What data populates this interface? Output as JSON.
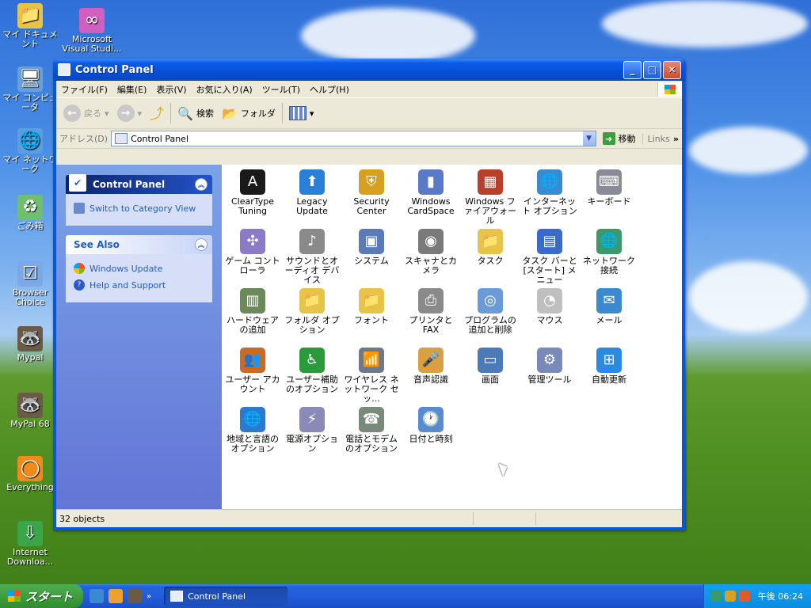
{
  "desktop": {
    "icons": [
      {
        "label": "マイ ドキュメント",
        "glyph": "📁",
        "color": "#e8c34a"
      },
      {
        "label": "Microsoft Visual Studi...",
        "glyph": "∞",
        "color": "#d060c0"
      },
      {
        "label": "マイ コンピュータ",
        "glyph": "🖥",
        "color": "#6a9fd8"
      },
      {
        "label": "マイ ネットワーク",
        "glyph": "🌐",
        "color": "#5a9fe0"
      },
      {
        "label": "ごみ箱",
        "glyph": "♻",
        "color": "#6fbf6f"
      },
      {
        "label": "Browser Choice",
        "glyph": "☑",
        "color": "#7aa8e8"
      },
      {
        "label": "Mypal",
        "glyph": "🦝",
        "color": "#6b5a45"
      },
      {
        "label": "MyPal 68",
        "glyph": "🦝",
        "color": "#6b5a45"
      },
      {
        "label": "Everything",
        "glyph": "◯",
        "color": "#f08a1a"
      },
      {
        "label": "Internet Downloa...",
        "glyph": "⇩",
        "color": "#3aa64a"
      }
    ]
  },
  "window": {
    "title": "Control Panel",
    "buttons": {
      "minimize": "_",
      "maximize": "□",
      "close": "✕"
    },
    "menu": [
      "ファイル(F)",
      "編集(E)",
      "表示(V)",
      "お気に入り(A)",
      "ツール(T)",
      "ヘルプ(H)"
    ],
    "toolbar": {
      "back": "戻る",
      "search": "検索",
      "folders": "フォルダ"
    },
    "address": {
      "label": "アドレス(D)",
      "value": "Control Panel",
      "go": "移動",
      "links": "Links"
    },
    "sidebar": {
      "panel1": {
        "title": "Control Panel",
        "link": "Switch to Category View"
      },
      "panel2": {
        "title": "See Also",
        "links": [
          "Windows Update",
          "Help and Support"
        ]
      }
    },
    "items": [
      {
        "label": "ClearType Tuning",
        "glyph": "A",
        "color": "#1a1a1a"
      },
      {
        "label": "Legacy Update",
        "glyph": "⬆",
        "color": "#2a7fd8"
      },
      {
        "label": "Security Center",
        "glyph": "⛨",
        "color": "#d8a020"
      },
      {
        "label": "Windows CardSpace",
        "glyph": "▮",
        "color": "#5a7ac8"
      },
      {
        "label": "Windows ファイアウォール",
        "glyph": "▦",
        "color": "#b8402a"
      },
      {
        "label": "インターネット オプション",
        "glyph": "🌐",
        "color": "#3a8ad0"
      },
      {
        "label": "キーボード",
        "glyph": "⌨",
        "color": "#8a8a9a"
      },
      {
        "label": "ゲーム コントローラ",
        "glyph": "✣",
        "color": "#8a7ac8"
      },
      {
        "label": "サウンドとオーディオ デバイス",
        "glyph": "♪",
        "color": "#8a8a8a"
      },
      {
        "label": "システム",
        "glyph": "▣",
        "color": "#5a7ab8"
      },
      {
        "label": "スキャナとカメラ",
        "glyph": "◉",
        "color": "#7a7a7a"
      },
      {
        "label": "タスク",
        "glyph": "📁",
        "color": "#e8c34a"
      },
      {
        "label": "タスク バーと [スタート] メニュー",
        "glyph": "▤",
        "color": "#3a6ad0"
      },
      {
        "label": "ネットワーク接続",
        "glyph": "🌐",
        "color": "#3a9a6a"
      },
      {
        "label": "ハードウェアの追加",
        "glyph": "▥",
        "color": "#6a8a5a"
      },
      {
        "label": "フォルダ オプション",
        "glyph": "📁",
        "color": "#e8c34a"
      },
      {
        "label": "フォント",
        "glyph": "📁",
        "color": "#e8c34a"
      },
      {
        "label": "プリンタと FAX",
        "glyph": "⎙",
        "color": "#8a8a8a"
      },
      {
        "label": "プログラムの追加と削除",
        "glyph": "◎",
        "color": "#6a9ad8"
      },
      {
        "label": "マウス",
        "glyph": "◔",
        "color": "#bfbfbf"
      },
      {
        "label": "メール",
        "glyph": "✉",
        "color": "#3a8ad0"
      },
      {
        "label": "ユーザー アカウント",
        "glyph": "👥",
        "color": "#c86a2a"
      },
      {
        "label": "ユーザー補助のオプション",
        "glyph": "♿",
        "color": "#2a9a3a"
      },
      {
        "label": "ワイヤレス ネットワーク セッ...",
        "glyph": "📶",
        "color": "#6a7a8a"
      },
      {
        "label": "音声認識",
        "glyph": "🎤",
        "color": "#d8a040"
      },
      {
        "label": "画面",
        "glyph": "▭",
        "color": "#4a7ab8"
      },
      {
        "label": "管理ツール",
        "glyph": "⚙",
        "color": "#7a8ab8"
      },
      {
        "label": "自動更新",
        "glyph": "⊞",
        "color": "#2a8ae0"
      },
      {
        "label": "地域と言語のオプション",
        "glyph": "🌐",
        "color": "#2a7ad0"
      },
      {
        "label": "電源オプション",
        "glyph": "⚡",
        "color": "#8a8ab8"
      },
      {
        "label": "電話とモデムのオプション",
        "glyph": "☎",
        "color": "#7a8a7a"
      },
      {
        "label": "日付と時刻",
        "glyph": "🕐",
        "color": "#5a8ad0"
      }
    ],
    "status": "32 objects"
  },
  "taskbar": {
    "start": "スタート",
    "task": "Control Panel",
    "clock": "午後 06:24"
  }
}
